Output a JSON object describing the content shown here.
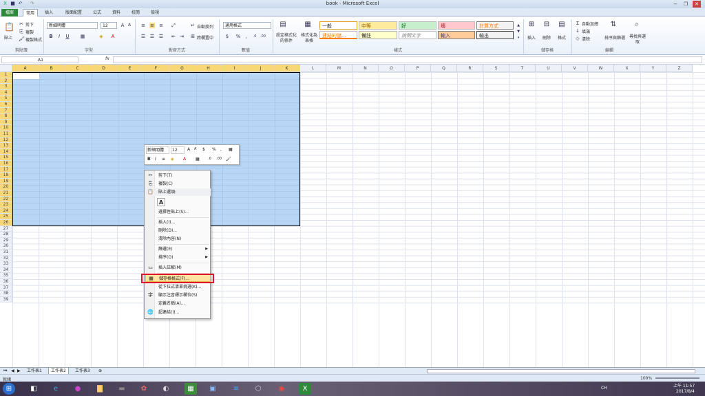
{
  "window": {
    "title": "book - Microsoft Excel"
  },
  "tabs": [
    "檔案",
    "常用",
    "插入",
    "版面配置",
    "公式",
    "資料",
    "校閱",
    "檢視"
  ],
  "clipboard": {
    "paste": "貼上",
    "cut": "剪下",
    "copy": "複製",
    "format_painter": "複製格式",
    "label": "剪貼簿"
  },
  "font": {
    "name": "新細明體",
    "size": "12",
    "label": "字型",
    "bold": "B",
    "italic": "I",
    "underline": "U"
  },
  "alignment": {
    "wrap": "自動換列",
    "merge": "跨欄置中",
    "label": "對齊方式"
  },
  "number": {
    "format": "通用格式",
    "currency": "$",
    "percent": "%",
    "comma": ",",
    "label": "數值"
  },
  "styles": {
    "conditional": "設定格式化的條件",
    "as_table": "格式化為表格",
    "cells": [
      "一般",
      "中等",
      "好",
      "壞",
      "計算方式",
      "連結的儲...",
      "備註",
      "說明文字",
      "輸入",
      "輸出"
    ],
    "label": "樣式"
  },
  "cells_group": {
    "insert": "插入",
    "delete": "刪除",
    "format": "格式",
    "label": "儲存格"
  },
  "editing": {
    "autosum": "自動加總",
    "fill": "填滿",
    "clear": "清除",
    "sort": "排序與篩選",
    "find": "尋找與選取",
    "label": "編輯"
  },
  "formula_bar": {
    "name_box": "A1",
    "fx": "fx",
    "formula": ""
  },
  "columns": [
    "A",
    "B",
    "C",
    "D",
    "E",
    "F",
    "G",
    "H",
    "I",
    "J",
    "K",
    "L",
    "M",
    "N",
    "O",
    "P",
    "Q",
    "R",
    "S",
    "T",
    "U",
    "V",
    "W",
    "X",
    "Y",
    "Z"
  ],
  "rows": [
    "1",
    "2",
    "3",
    "4",
    "5",
    "6",
    "7",
    "8",
    "9",
    "10",
    "11",
    "12",
    "13",
    "14",
    "15",
    "16",
    "17",
    "18",
    "19",
    "20",
    "21",
    "22",
    "23",
    "24",
    "25",
    "26",
    "27",
    "28",
    "29",
    "30",
    "31",
    "32",
    "33",
    "34",
    "35",
    "36",
    "37",
    "38",
    "39"
  ],
  "mini_toolbar": {
    "font": "新細明體",
    "size": "12",
    "bold": "B",
    "italic": "I",
    "percent": "%",
    "currency": "$",
    "comma": ","
  },
  "context_menu": {
    "cut": "剪下(T)",
    "copy": "複製(C)",
    "paste_options": "貼上選項:",
    "paste_icon": "A",
    "paste_special": "選擇性貼上(S)...",
    "insert": "插入(I)...",
    "delete": "刪除(D)...",
    "clear": "清除內容(N)",
    "filter": "篩選(E)",
    "sort": "排序(O)",
    "insert_comment": "插入註解(M)",
    "format_cells": "儲存格格式(F)...",
    "pick_list": "從下拉式清單挑選(K)...",
    "phonetic": "顯示注音標示欄位(S)",
    "define_name": "定義名稱(A)...",
    "hyperlink": "超連結(I)..."
  },
  "sheet_tabs": [
    "工作表1",
    "工作表2",
    "工作表3"
  ],
  "status": {
    "ready": "就緒",
    "zoom": "100%"
  },
  "taskbar": {
    "lang": "CH",
    "time": "上午 11:57",
    "date": "2017/8/4"
  }
}
